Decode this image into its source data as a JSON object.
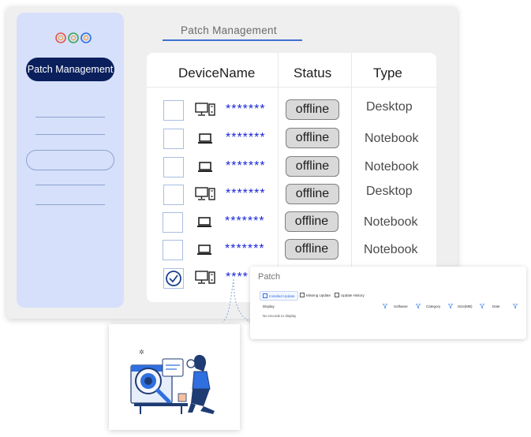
{
  "sidebar": {
    "active_item": "Patch Management"
  },
  "main": {
    "title": "Patch Management"
  },
  "table": {
    "headers": [
      "DeviceName",
      "Status",
      "Type"
    ],
    "rows": [
      {
        "name": "*******",
        "status": "offline",
        "type": "Desktop",
        "device_icon": "desktop-icon",
        "checked": false
      },
      {
        "name": "*******",
        "status": "offline",
        "type": "Notebook",
        "device_icon": "laptop-icon",
        "checked": false
      },
      {
        "name": "*******",
        "status": "offline",
        "type": "Notebook",
        "device_icon": "laptop-icon",
        "checked": false
      },
      {
        "name": "*******",
        "status": "offline",
        "type": "Desktop",
        "device_icon": "desktop-icon",
        "checked": false
      },
      {
        "name": "*******",
        "status": "offline",
        "type": "Notebook",
        "device_icon": "laptop-icon",
        "checked": false
      },
      {
        "name": "*******",
        "status": "offline",
        "type": "Notebook",
        "device_icon": "laptop-icon",
        "checked": false
      },
      {
        "name": "****",
        "status": "",
        "type": "",
        "device_icon": "desktop-icon",
        "checked": true
      }
    ]
  },
  "patch_popup": {
    "title": "Patch",
    "tabs": [
      "Installed Update",
      "Missing Update",
      "Update History"
    ],
    "active_tab": "Installed Update",
    "columns": [
      "Display",
      "Software",
      "Category",
      "Size(MB)",
      "Date"
    ],
    "empty_text": "No records to display"
  },
  "colors": {
    "sidebar_bg": "#d6e0fb",
    "nav_active_bg": "#0a1f5c",
    "accent_blue": "#3f71d0",
    "masked_text": "#1a25d8",
    "status_pill": "#d9d9d9"
  }
}
